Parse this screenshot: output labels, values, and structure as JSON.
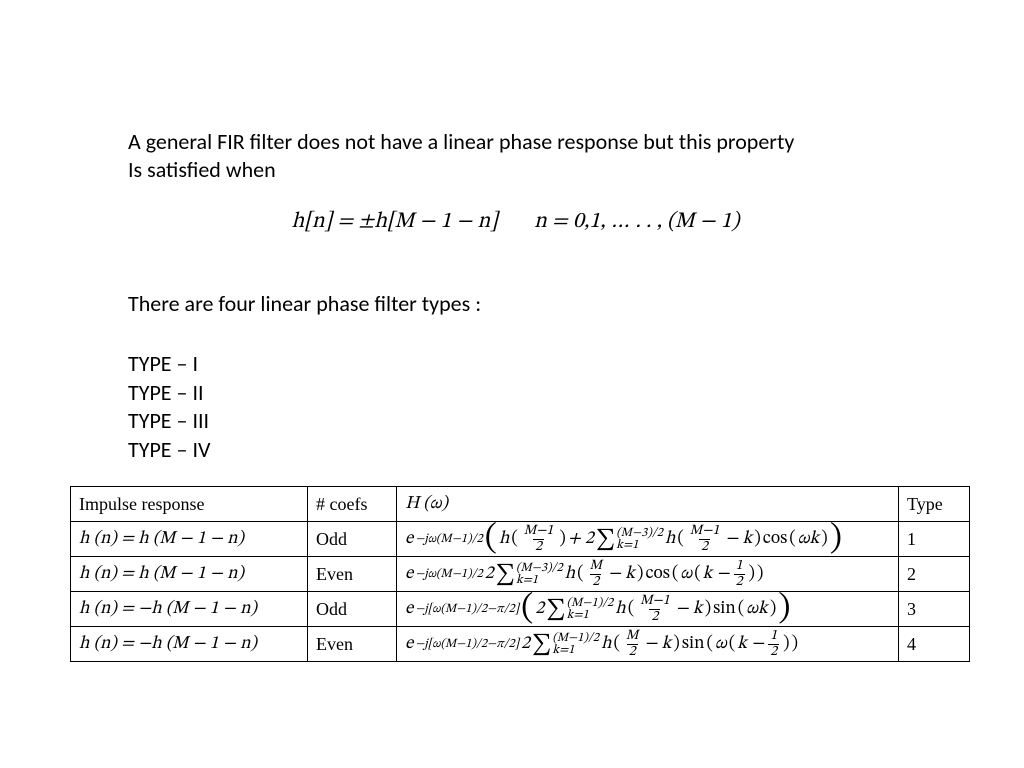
{
  "intro_line1": "A general   FIR filter does not have a linear phase response  but this property",
  "intro_line2": "Is satisfied when",
  "equation": {
    "lhs": "h[n] =  ±h[M − 1 − n]",
    "rhs": "n = 0,1, … . . , (M − 1)"
  },
  "intro2": "There are four linear phase filter types :",
  "types": [
    "TYPE – I",
    "TYPE – II",
    "TYPE – III",
    "TYPE – IV"
  ],
  "table": {
    "headers": [
      "Impulse response",
      "# coefs",
      "H (ω)",
      "Type"
    ],
    "rows": [
      {
        "impulse": "h (n) = h (M − 1 − n)",
        "coefs": "Odd",
        "H_exp": "−jω(M−1)/2",
        "H_inner_prefix_frac_num": "M−1",
        "H_inner_prefix_frac_den": "2",
        "H_has_prefix_term": true,
        "H_multiplier": "2",
        "H_sum_upper": "(M−3)/2",
        "H_sum_lower": "k=1",
        "H_arg_frac_num": "M−1",
        "H_arg_frac_den": "2",
        "H_trig": "cos",
        "H_trig_arg": "ωk",
        "H_half_shift": false,
        "H_big_parens": true,
        "type": "1"
      },
      {
        "impulse": "h (n) = h (M − 1 − n)",
        "coefs": "Even",
        "H_exp": "−jω(M−1)/2",
        "H_multiplier": "2",
        "H_sum_upper": "(M−3)/2",
        "H_sum_lower": "k=1",
        "H_arg_frac_num": "M",
        "H_arg_frac_den": "2",
        "H_trig": "cos",
        "H_has_prefix_term": false,
        "H_half_shift": true,
        "H_big_parens": false,
        "type": "2"
      },
      {
        "impulse": "h (n) = −h (M − 1 − n)",
        "coefs": "Odd",
        "H_exp": "−j[ω(M−1)/2−π/2]",
        "H_multiplier": "2",
        "H_sum_upper": "(M−1)/2",
        "H_sum_lower": "k=1",
        "H_arg_frac_num": "M−1",
        "H_arg_frac_den": "2",
        "H_trig": "sin",
        "H_trig_arg": "ωk",
        "H_has_prefix_term": false,
        "H_half_shift": false,
        "H_big_parens": true,
        "type": "3"
      },
      {
        "impulse": "h (n) = −h (M − 1 − n)",
        "coefs": "Even",
        "H_exp": "−j[ω(M−1)/2−π/2]",
        "H_multiplier": "2",
        "H_sum_upper": "(M−1)/2",
        "H_sum_lower": "k=1",
        "H_arg_frac_num": "M",
        "H_arg_frac_den": "2",
        "H_trig": "sin",
        "H_has_prefix_term": false,
        "H_half_shift": true,
        "H_big_parens": false,
        "type": "4"
      }
    ]
  }
}
